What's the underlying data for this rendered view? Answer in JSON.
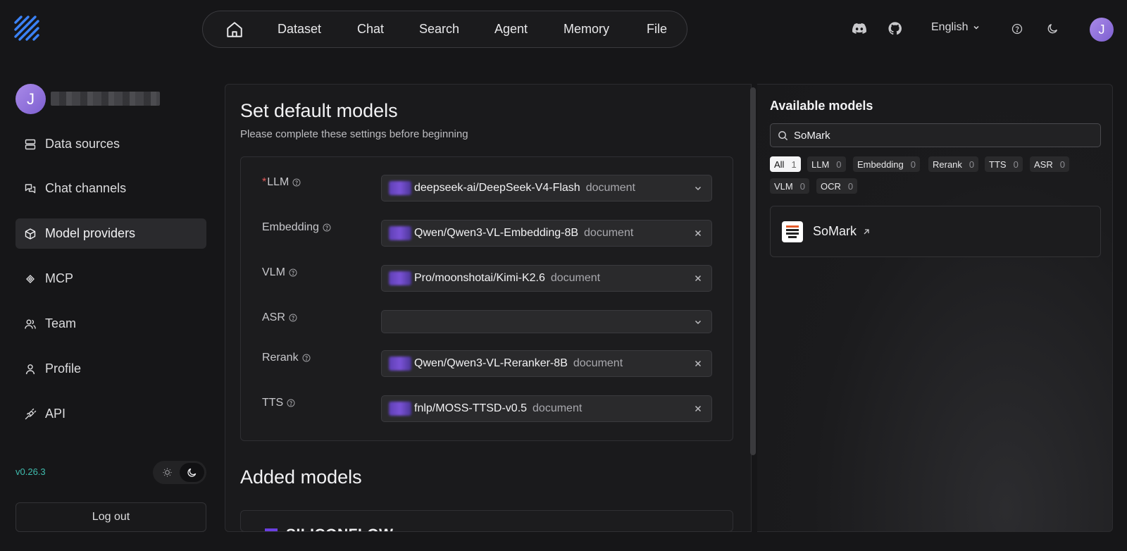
{
  "nav": {
    "items": [
      "Dataset",
      "Chat",
      "Search",
      "Agent",
      "Memory",
      "File"
    ],
    "language": "English",
    "user_initial": "J"
  },
  "sidebar": {
    "user_initial": "J",
    "items": [
      {
        "label": "Data sources",
        "icon": "database-icon"
      },
      {
        "label": "Chat channels",
        "icon": "chat-channels-icon"
      },
      {
        "label": "Model providers",
        "icon": "cube-icon",
        "active": true
      },
      {
        "label": "MCP",
        "icon": "mcp-icon"
      },
      {
        "label": "Team",
        "icon": "team-icon"
      },
      {
        "label": "Profile",
        "icon": "user-icon"
      },
      {
        "label": "API",
        "icon": "plug-icon"
      }
    ],
    "version": "v0.26.3",
    "logout_label": "Log out"
  },
  "main": {
    "title": "Set default models",
    "subtitle": "Please complete these settings before beginning",
    "fields": [
      {
        "label": "LLM",
        "required": true,
        "value": "deepseek-ai/DeepSeek-V4-Flash",
        "tag": "document",
        "end": "chevron"
      },
      {
        "label": "Embedding",
        "required": false,
        "value": "Qwen/Qwen3-VL-Embedding-8B",
        "tag": "document",
        "end": "clear"
      },
      {
        "label": "VLM",
        "required": false,
        "value": "Pro/moonshotai/Kimi-K2.6",
        "tag": "document",
        "end": "clear"
      },
      {
        "label": "ASR",
        "required": false,
        "value": "",
        "tag": "",
        "end": "chevron"
      },
      {
        "label": "Rerank",
        "required": false,
        "value": "Qwen/Qwen3-VL-Reranker-8B",
        "tag": "document",
        "end": "clear"
      },
      {
        "label": "TTS",
        "required": false,
        "value": "fnlp/MOSS-TTSD-v0.5",
        "tag": "document",
        "end": "clear"
      }
    ],
    "required_mark": "*",
    "added_title": "Added models",
    "added_provider": "SILICONFLOW"
  },
  "available": {
    "title": "Available models",
    "search_value": "SoMark",
    "filters": [
      {
        "label": "All",
        "count": "1",
        "active": true
      },
      {
        "label": "LLM",
        "count": "0"
      },
      {
        "label": "Embedding",
        "count": "0"
      },
      {
        "label": "Rerank",
        "count": "0"
      },
      {
        "label": "TTS",
        "count": "0"
      },
      {
        "label": "ASR",
        "count": "0"
      },
      {
        "label": "VLM",
        "count": "0"
      },
      {
        "label": "OCR",
        "count": "0"
      }
    ],
    "models": [
      {
        "name": "SoMark",
        "icon": "somark-logo"
      }
    ]
  },
  "colors": {
    "accent": "#7d5fd0",
    "version": "#3fbcae",
    "required": "#e25a5a"
  }
}
